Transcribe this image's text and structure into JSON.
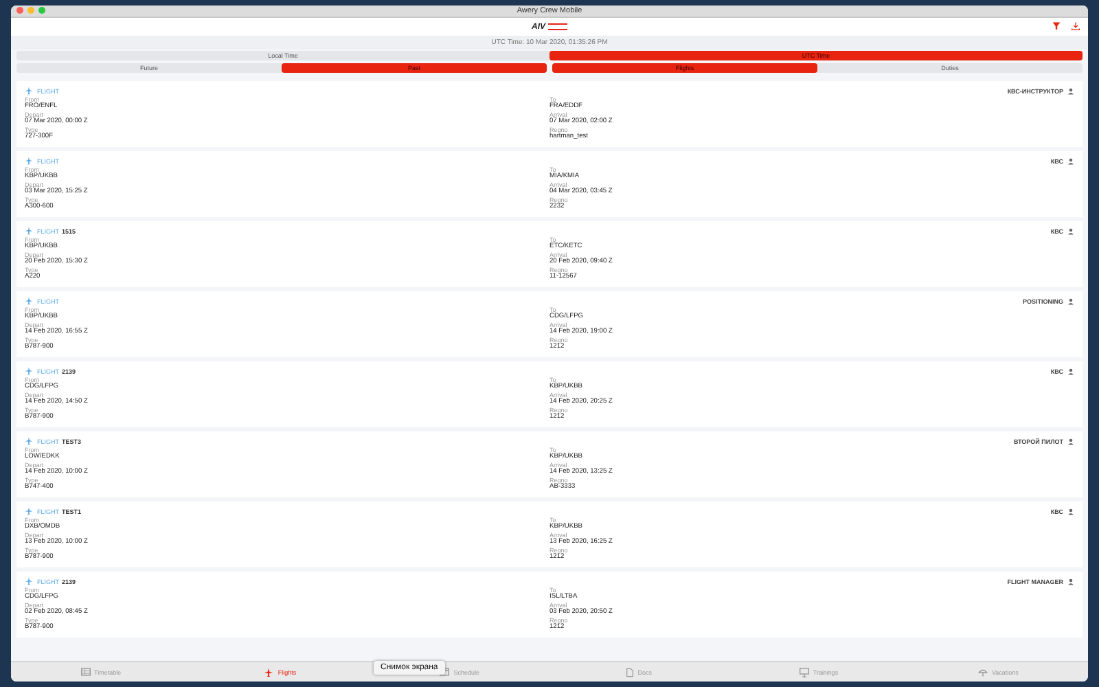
{
  "window": {
    "title": "Awery Crew Mobile"
  },
  "header": {
    "logo": "AIV",
    "utc_time": "UTC Time: 10 Mar 2020, 01:35:26 PM"
  },
  "time_zone_tabs": [
    {
      "label": "Local Time",
      "selected": false
    },
    {
      "label": "UTC Time",
      "selected": true
    }
  ],
  "period_tabs": [
    {
      "label": "Future",
      "selected": false
    },
    {
      "label": "Past",
      "selected": true
    }
  ],
  "type_tabs": [
    {
      "label": "Flights",
      "selected": true
    },
    {
      "label": "Duties",
      "selected": false
    }
  ],
  "flights": [
    {
      "label": "FLIGHT",
      "role": "КВС-ИНСТРУКТОР",
      "from_label": "From",
      "from": "FRO/ENFL",
      "to_label": "To",
      "to": "FRA/EDDF",
      "depart_label": "Depart",
      "depart": "07 Mar 2020, 00:00 Z",
      "arrival_label": "Arrival",
      "arrival": "07 Mar 2020, 02:00 Z",
      "type_label": "Type",
      "type": "727-300F",
      "regno_label": "Regno",
      "regno": "hartman_test"
    },
    {
      "label": "FLIGHT",
      "role": "КВС",
      "from_label": "From",
      "from": "KBP/UKBB",
      "to_label": "To",
      "to": "MIA/KMIA",
      "depart_label": "Depart",
      "depart": "03 Mar 2020, 15:25 Z",
      "arrival_label": "Arrival",
      "arrival": "04 Mar 2020, 03:45 Z",
      "type_label": "Type",
      "type": "A300-600",
      "regno_label": "Regno",
      "regno": "2232"
    },
    {
      "label": "FLIGHT",
      "number": "1515",
      "role": "КВС",
      "from_label": "From",
      "from": "KBP/UKBB",
      "to_label": "To",
      "to": "ETC/KETC",
      "depart_label": "Depart",
      "depart": "20 Feb 2020, 15:30 Z",
      "arrival_label": "Arrival",
      "arrival": "20 Feb 2020, 09:40 Z",
      "type_label": "Type",
      "type": "A220",
      "regno_label": "Regno",
      "regno": "11-12567"
    },
    {
      "label": "FLIGHT",
      "role": "POSITIONING",
      "from_label": "From",
      "from": "KBP/UKBB",
      "to_label": "To",
      "to": "CDG/LFPG",
      "depart_label": "Depart",
      "depart": "14 Feb 2020, 16:55 Z",
      "arrival_label": "Arrival",
      "arrival": "14 Feb 2020, 19:00 Z",
      "type_label": "Type",
      "type": "B787-900",
      "regno_label": "Regno",
      "regno": "1212"
    },
    {
      "label": "FLIGHT",
      "number": "2139",
      "role": "КВС",
      "from_label": "From",
      "from": "CDG/LFPG",
      "to_label": "To",
      "to": "KBP/UKBB",
      "depart_label": "Depart",
      "depart": "14 Feb 2020, 14:50 Z",
      "arrival_label": "Arrival",
      "arrival": "14 Feb 2020, 20:25 Z",
      "type_label": "Type",
      "type": "B787-900",
      "regno_label": "Regno",
      "regno": "1212"
    },
    {
      "label": "FLIGHT",
      "number": "TEST3",
      "role": "ВТОРОЙ ПИЛОТ",
      "from_label": "From",
      "from": "LOW/EDKK",
      "to_label": "To",
      "to": "KBP/UKBB",
      "depart_label": "Depart",
      "depart": "14 Feb 2020, 10:00 Z",
      "arrival_label": "Arrival",
      "arrival": "14 Feb 2020, 13:25 Z",
      "type_label": "Type",
      "type": "B747-400",
      "regno_label": "Regno",
      "regno": "AB-3333"
    },
    {
      "label": "FLIGHT",
      "number": "TEST1",
      "role": "КВС",
      "from_label": "From",
      "from": "DXB/OMDB",
      "to_label": "To",
      "to": "KBP/UKBB",
      "depart_label": "Depart",
      "depart": "13 Feb 2020, 10:00 Z",
      "arrival_label": "Arrival",
      "arrival": "13 Feb 2020, 16:25 Z",
      "type_label": "Type",
      "type": "B787-900",
      "regno_label": "Regno",
      "regno": "1212"
    },
    {
      "label": "FLIGHT",
      "number": "2139",
      "role": "FLIGHT MANAGER",
      "from_label": "From",
      "from": "CDG/LFPG",
      "to_label": "To",
      "to": "ISL/LTBA",
      "depart_label": "Depart",
      "depart": "02 Feb 2020, 08:45 Z",
      "arrival_label": "Arrival",
      "arrival": "03 Feb 2020, 20:50 Z",
      "type_label": "Type",
      "type": "B787-900",
      "regno_label": "Regno",
      "regno": "1212"
    }
  ],
  "tab_bar": [
    {
      "kind": "timetable",
      "label": "Timetable",
      "selected": false
    },
    {
      "kind": "flights",
      "label": "Flights",
      "selected": true
    },
    {
      "kind": "schedule",
      "label": "Schedule",
      "selected": false
    },
    {
      "kind": "docs",
      "label": "Docs",
      "selected": false
    },
    {
      "kind": "trainings",
      "label": "Trainings",
      "selected": false
    },
    {
      "kind": "vacations",
      "label": "Vacations",
      "selected": false
    }
  ],
  "tooltip": "Снимок экрана"
}
